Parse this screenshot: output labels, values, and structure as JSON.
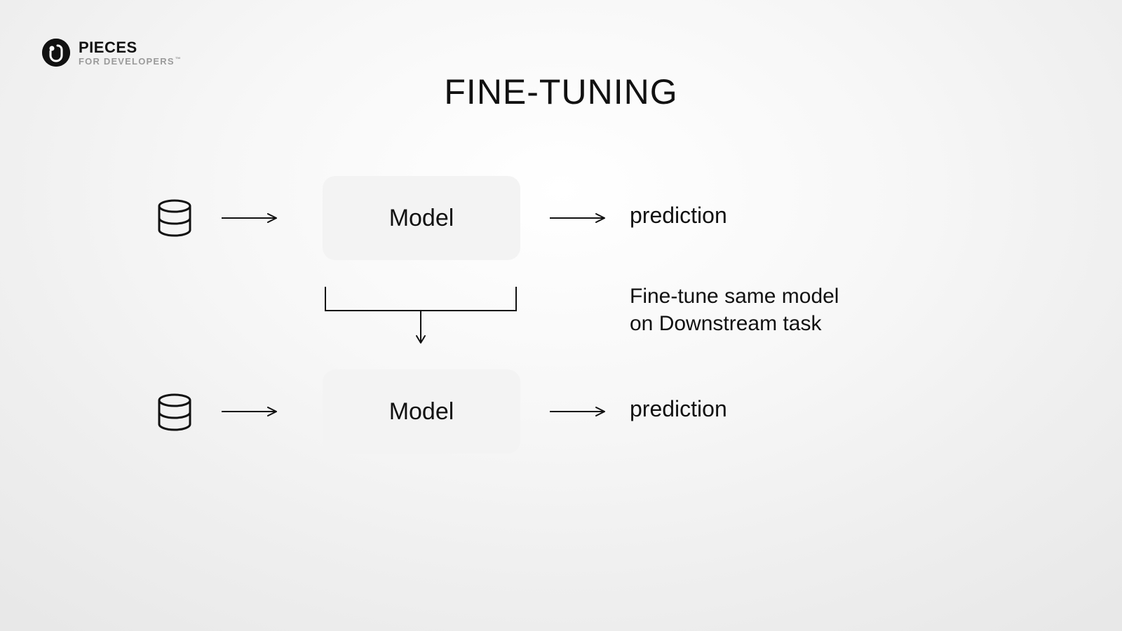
{
  "brand": {
    "title": "PIECES",
    "subtitle": "FOR DEVELOPERS",
    "tm": "™"
  },
  "header": {
    "title": "FINE-TUNING"
  },
  "diagram": {
    "row1": {
      "box_label": "Model",
      "output_label": "prediction"
    },
    "row2": {
      "box_label": "Model",
      "output_label": "prediction"
    },
    "annotation_line1": "Fine-tune same model",
    "annotation_line2": "on Downstream task"
  }
}
